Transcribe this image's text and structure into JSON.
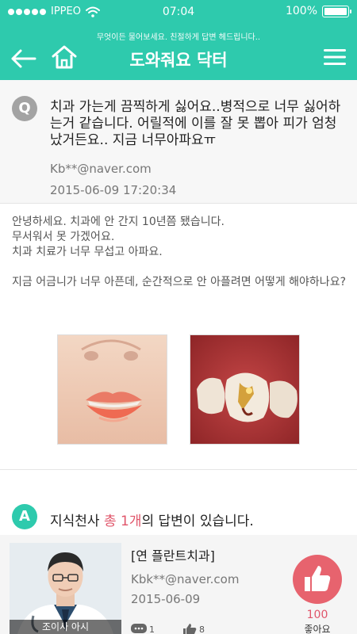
{
  "status_bar": {
    "carrier": "IPPEO",
    "time": "07:04",
    "battery": "100%"
  },
  "header": {
    "tagline": "무엇이든 물어보세요. 친절하게 답변 헤드립니다..",
    "title": "도와줘요 닥터"
  },
  "question": {
    "badge": "Q",
    "text": "치과 가는게 끔찍하게 싫어요..병적으로 너무 싫어하는거 같습니다. 어릴적에 이를 잘 못 뽑아 피가 엄청 났거든요.. 지금 너무아파요ㅠ",
    "email": "Kb**@naver.com",
    "datetime": "2015-06-09  17:20:34"
  },
  "body": {
    "lines": [
      "안녕하세요. 치과에 안 간지 10년쯤 됐습니다.",
      "무서워서 못 가겠어요.",
      "치과 치료가 너무 무섭고 아파요.",
      "지금 어금니가 너무 아픈데, 순간적으로 안 아플려면 어떻게 해야하나요?"
    ]
  },
  "answers": {
    "badge": "A",
    "prefix": "지식천사 ",
    "count": "총 1개",
    "suffix": "의 답변이 있습니다.",
    "items": [
      {
        "clinic": "[연 플란트치과]",
        "email": "Kbk**@naver.com",
        "date": "2015-06-09",
        "comments": "1",
        "likes_small": "8",
        "like_count": "100",
        "like_label": "좋아요"
      }
    ]
  },
  "colors": {
    "accent": "#2ecaad",
    "like": "#e7636e",
    "highlight": "#e0556a"
  }
}
